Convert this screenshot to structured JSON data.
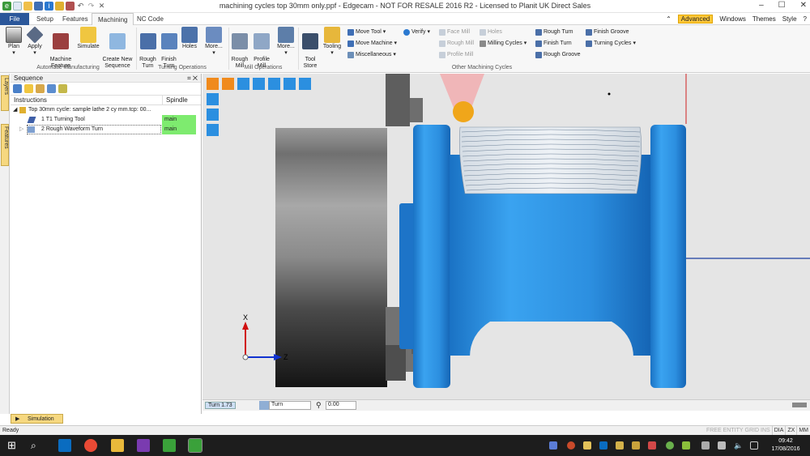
{
  "window": {
    "title": "machining cycles top 30mm only.ppf - Edgecam - NOT FOR RESALE 2016 R2  - Licensed to Planit UK Direct Sales"
  },
  "menu": {
    "tabs": [
      "File",
      "Setup",
      "Features",
      "Machining",
      "NC Code"
    ],
    "active": "Machining",
    "right": {
      "advanced": "Advanced",
      "windows": "Windows",
      "themes": "Themes",
      "style": "Style"
    }
  },
  "ribbon": {
    "automatic": {
      "buttons": [
        "Plan",
        "Apply",
        "Machine\nFeature",
        "Simulate",
        "Create New\nSequence"
      ],
      "group": "Automatic Manufacturing"
    },
    "turning": {
      "buttons": [
        "Rough\nTurn",
        "Finish\nTurn",
        "Holes",
        "More..."
      ],
      "group": "Turning Operations"
    },
    "mill": {
      "buttons": [
        "Rough\nMill",
        "Profile\nMill",
        "More..."
      ],
      "group": "Mill Operations"
    },
    "tools": {
      "tool_store": "Tool\nStore",
      "tooling": "Tooling"
    },
    "move": {
      "move_tool": "Move Tool",
      "move_machine": "Move Machine",
      "misc": "Miscellaneous"
    },
    "verify": "Verify",
    "other": {
      "face_mill": "Face Mill",
      "rough_mill": "Rough Mill",
      "profile_mill": "Profile Mill",
      "holes": "Holes",
      "milling_cycles": "Milling Cycles",
      "group": "Other Machining Cycles"
    },
    "turn_cycles": {
      "rough_turn": "Rough Turn",
      "finish_turn": "Finish Turn",
      "rough_groove": "Rough Groove",
      "finish_groove": "Finish Groove",
      "turning_cycles": "Turning Cycles"
    }
  },
  "side_tabs": {
    "layers": "Layers",
    "features": "Features"
  },
  "sequence": {
    "title": "Sequence",
    "pin": "⌗",
    "close": "✕",
    "columns": {
      "instructions": "Instructions",
      "spindle": "Spindle"
    },
    "root": "Top 30mm cycle: sample lathe 2 cy mm.tcp: 00...",
    "rows": [
      {
        "label": "1 T1 Turning Tool",
        "spindle": "main"
      },
      {
        "label": "2 Rough Waveform Turn",
        "spindle": "main"
      }
    ]
  },
  "viewport": {
    "axes": {
      "x": "X",
      "z": "Z"
    },
    "colors": {
      "part": "#2f9ae8",
      "part_dark": "#1670c2",
      "chuck": "#7a7a7a",
      "background": "#e5e5e5"
    }
  },
  "viewport_status": {
    "cpl": "Turn 1.73",
    "mode": "Turn",
    "value": "0.00"
  },
  "simulation_tab": "Simulation",
  "status": {
    "text": "Ready",
    "indicators": [
      "FREE",
      "ENTITY",
      "GRID",
      "INS",
      "DIA",
      "ZX",
      "MM"
    ]
  },
  "taskbar": {
    "time": "09:42",
    "date": "17/08/2016"
  }
}
